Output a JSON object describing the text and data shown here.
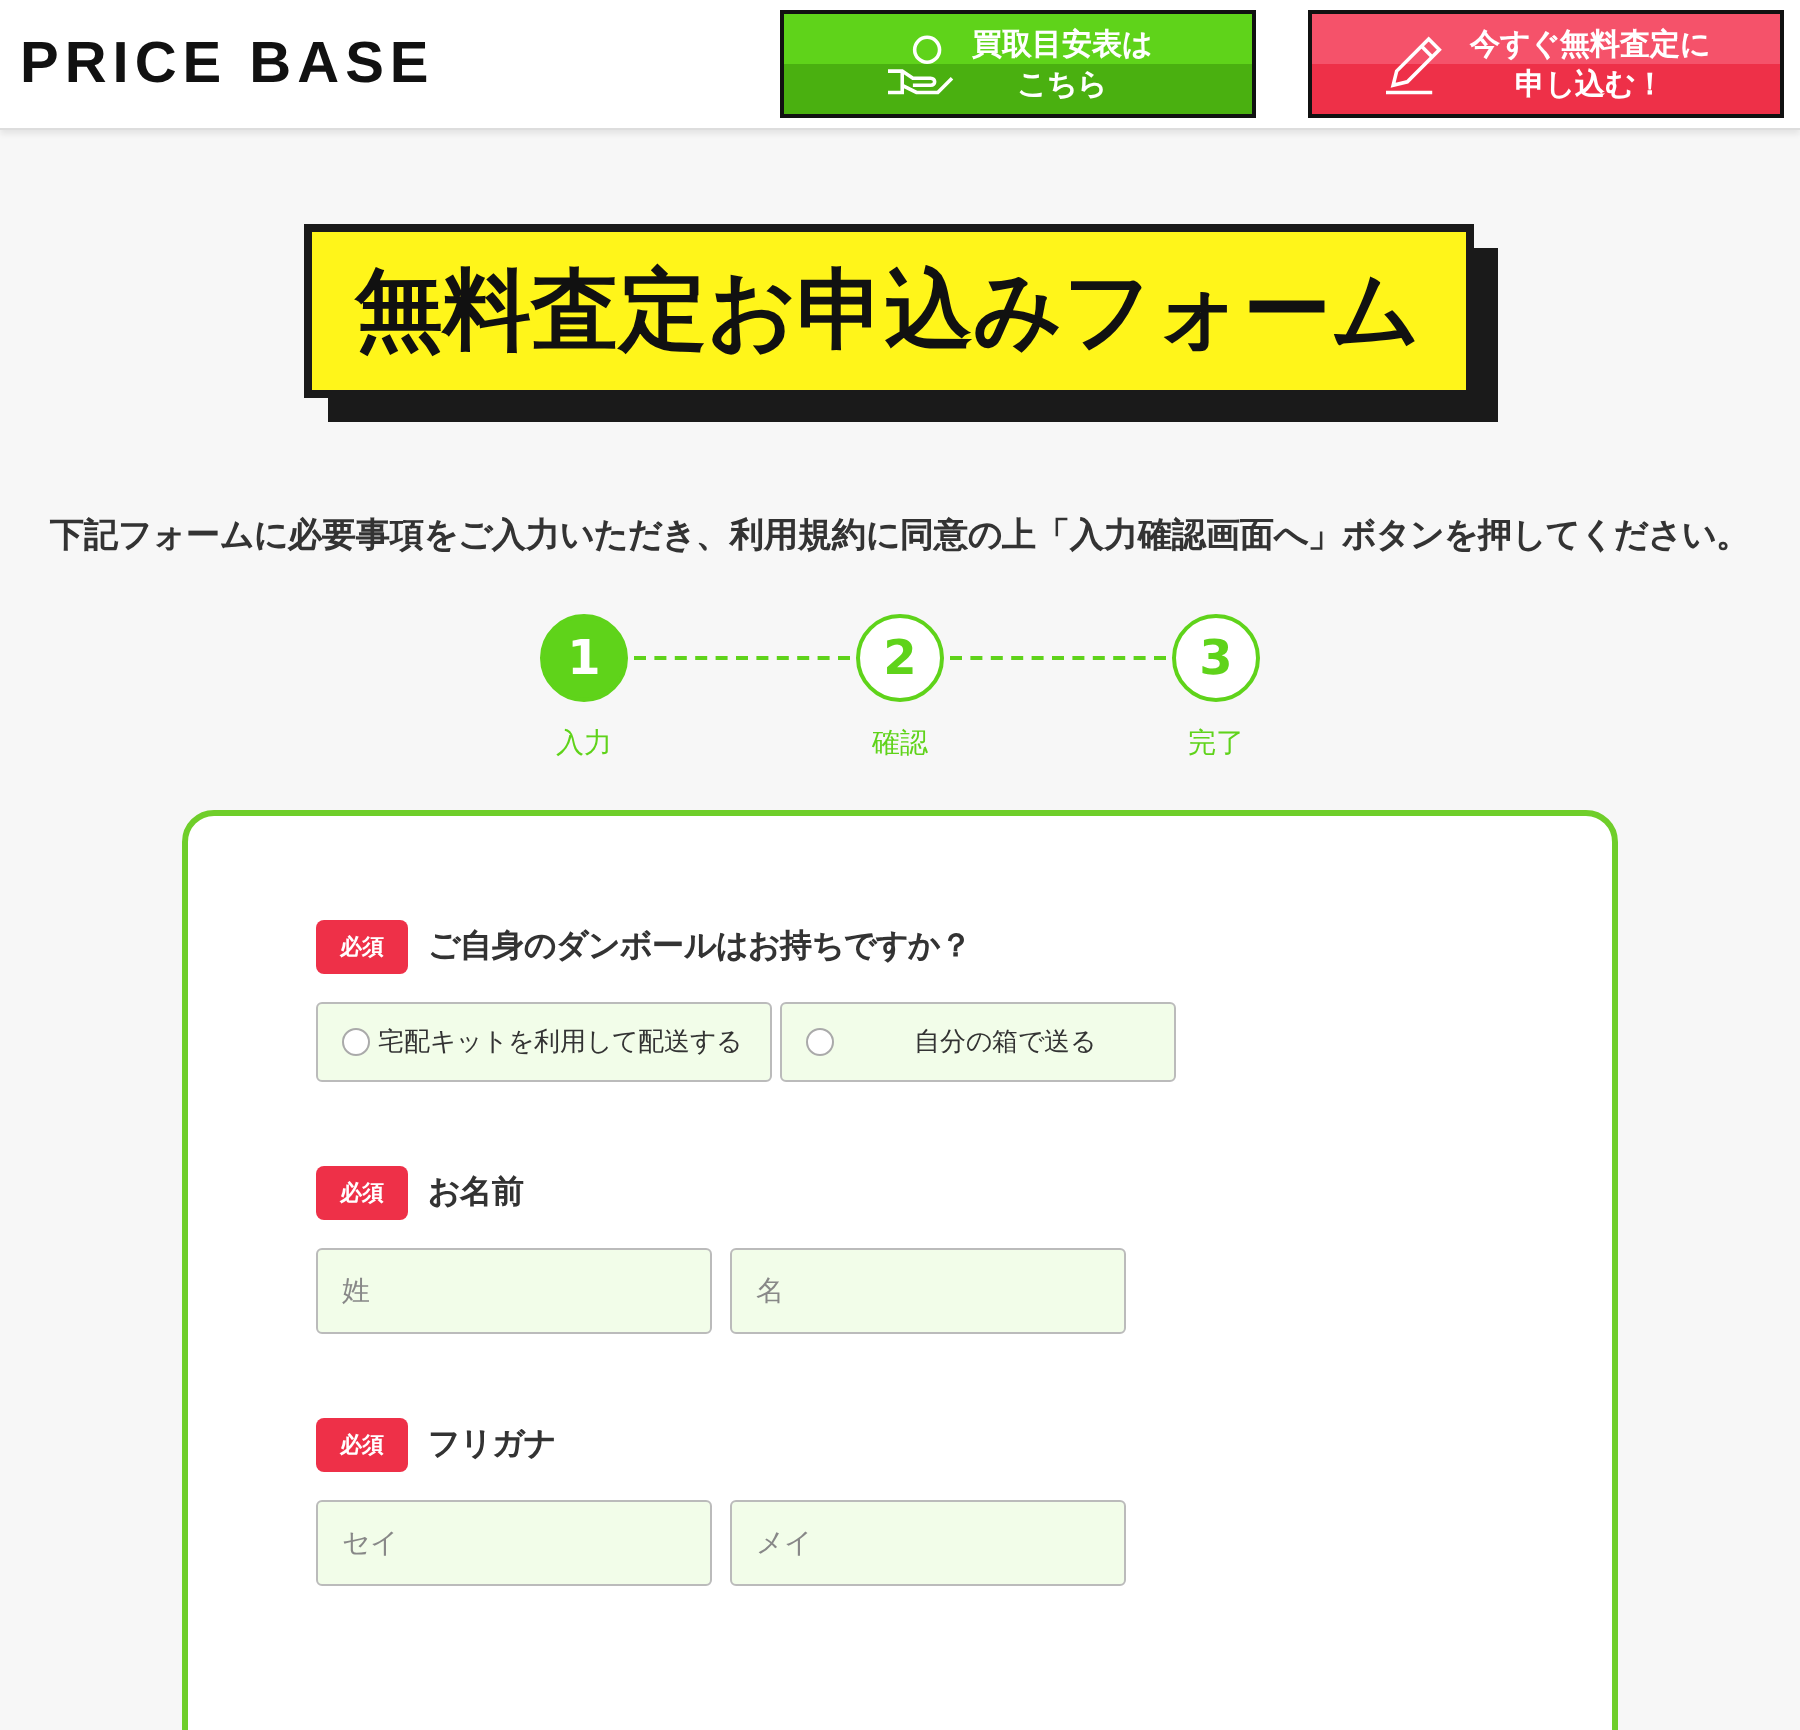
{
  "header": {
    "logo": "PRICE BASE",
    "buttons": [
      {
        "kind": "price",
        "lines": [
          "買取目安表は",
          "こちら"
        ]
      },
      {
        "kind": "apply",
        "lines": [
          "今すぐ無料査定に",
          "申し込む！"
        ]
      }
    ]
  },
  "title": "無料査定お申込みフォーム",
  "description": "下記フォームに必要事項をご入力いただき、利用規約に同意の上「入力確認画面へ」ボタンを押してください。",
  "steps": [
    {
      "number": "1",
      "label": "入力",
      "selected": true
    },
    {
      "number": "2",
      "label": "確認",
      "selected": false
    },
    {
      "number": "3",
      "label": "完了",
      "selected": false
    }
  ],
  "form": {
    "fields": [
      {
        "kind": "radio",
        "badge": "必須",
        "label": "ご自身のダンボールはお持ちですか？",
        "options": [
          {
            "label": "宅配キットを利用して配送する",
            "selected": false
          },
          {
            "label": "自分の箱で送る",
            "selected": false
          }
        ]
      },
      {
        "kind": "text",
        "badge": "必須",
        "label": "お名前",
        "inputs": [
          {
            "placeholder": "姓"
          },
          {
            "placeholder": "名"
          }
        ]
      },
      {
        "kind": "text",
        "badge": "必須",
        "label": "フリガナ",
        "inputs": [
          {
            "placeholder": "セイ"
          },
          {
            "placeholder": "メイ"
          }
        ]
      }
    ]
  }
}
